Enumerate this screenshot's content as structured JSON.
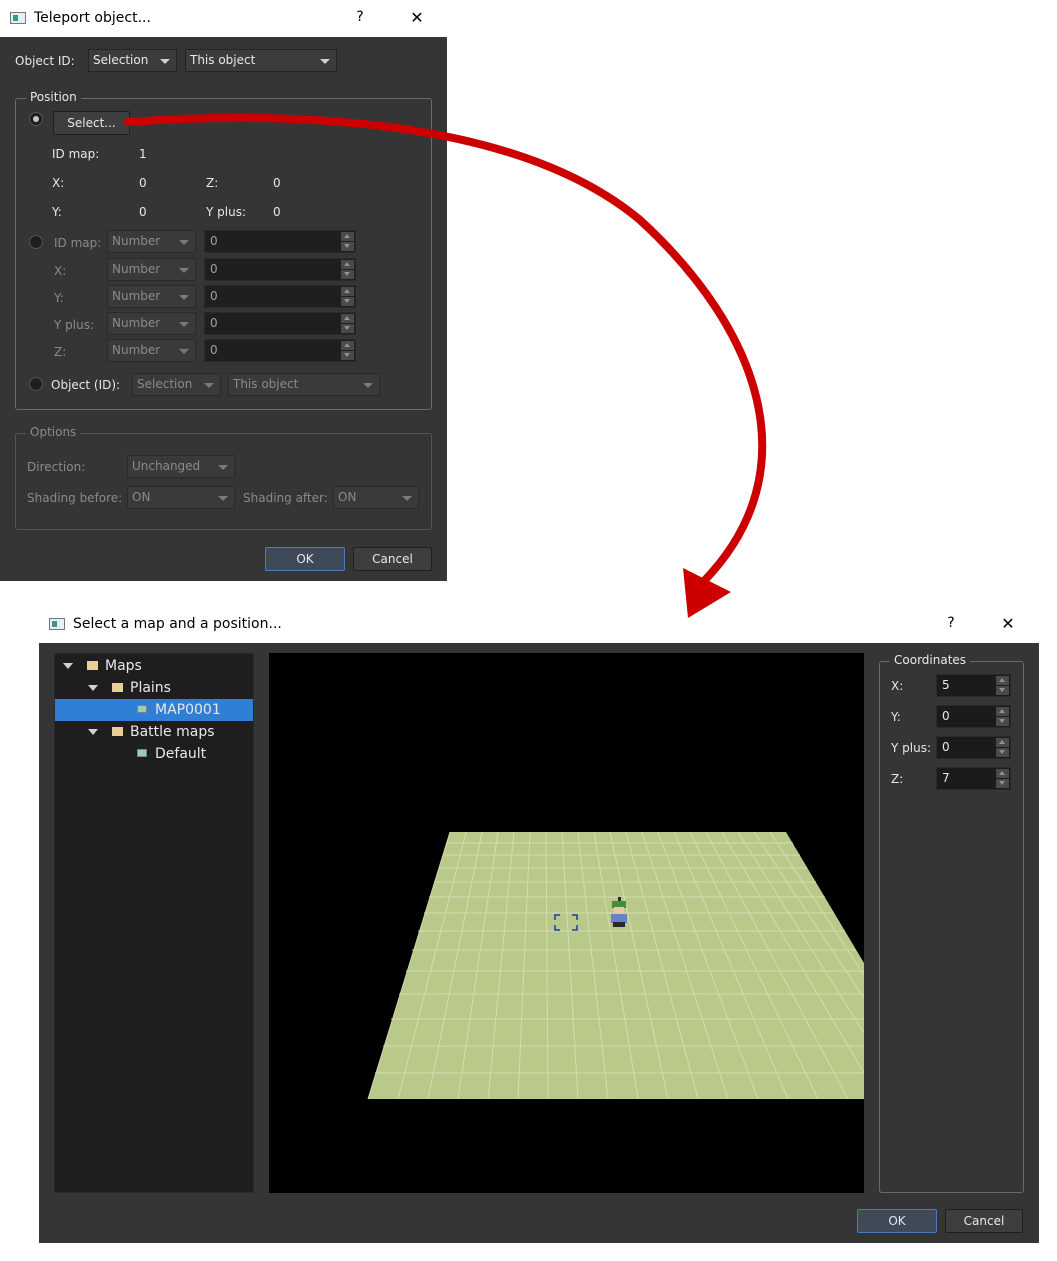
{
  "teleport_dialog": {
    "title": "Teleport object...",
    "help": "?",
    "close": "✕",
    "object_id_label": "Object ID:",
    "object_id_combo": "Selection",
    "object_target_combo": "This object",
    "position_group": "Position",
    "select_button": "Select...",
    "summary": {
      "id_map_label": "ID map:",
      "id_map_value": "1",
      "x_label": "X:",
      "x_value": "0",
      "z_label": "Z:",
      "z_value": "0",
      "y_label": "Y:",
      "y_value": "0",
      "yplus_label": "Y plus:",
      "yplus_value": "0"
    },
    "fields": [
      {
        "label": "ID map:",
        "combo": "Number",
        "value": "0"
      },
      {
        "label": "X:",
        "combo": "Number",
        "value": "0"
      },
      {
        "label": "Y:",
        "combo": "Number",
        "value": "0"
      },
      {
        "label": "Y plus:",
        "combo": "Number",
        "value": "0"
      },
      {
        "label": "Z:",
        "combo": "Number",
        "value": "0"
      }
    ],
    "object_radio_label": "Object (ID):",
    "object_radio_combo": "Selection",
    "object_radio_target": "This object",
    "options_group": "Options",
    "direction_label": "Direction:",
    "direction_value": "Unchanged",
    "shading_before_label": "Shading before:",
    "shading_before_value": "ON",
    "shading_after_label": "Shading after:",
    "shading_after_value": "ON",
    "ok": "OK",
    "cancel": "Cancel"
  },
  "select_dialog": {
    "title": "Select a map and a position...",
    "help": "?",
    "close": "✕",
    "tree": {
      "root": "Maps",
      "plains": "Plains",
      "map1": "MAP0001",
      "battle": "Battle maps",
      "default": "Default"
    },
    "coordinates_group": "Coordinates",
    "coords": [
      {
        "label": "X:",
        "value": "5"
      },
      {
        "label": "Y:",
        "value": "0"
      },
      {
        "label": "Y plus:",
        "value": "0"
      },
      {
        "label": "Z:",
        "value": "7"
      }
    ],
    "ok": "OK",
    "cancel": "Cancel"
  },
  "colors": {
    "dialog_bg": "#353535",
    "arrow": "#cc0000",
    "ground": "#b9c98a",
    "selection": "#2f7fd6"
  }
}
